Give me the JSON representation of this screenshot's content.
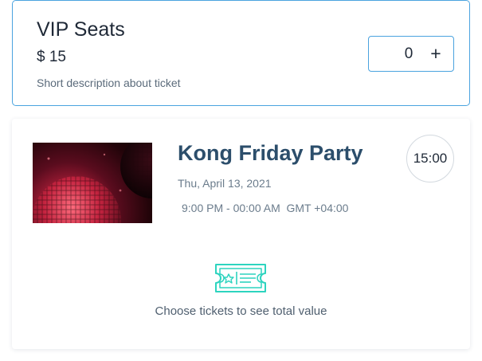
{
  "ticket": {
    "name": "VIP Seats",
    "price": "$ 15",
    "description": "Short description about ticket",
    "quantity": "0",
    "increment_label": "+"
  },
  "event": {
    "title": "Kong Friday Party",
    "date": "Thu, April 13, 2021",
    "time_range": "9:00 PM - 00:00 AM  GMT +04:00",
    "clock_time": "15:00",
    "image_icon": "disco-ball-photo"
  },
  "summary": {
    "icon": "ticket-icon",
    "message": "Choose tickets to see total value"
  },
  "colors": {
    "accent_border": "#4aa3df",
    "title": "#2c4e6b",
    "ticket_icon": "#2dd4bf"
  }
}
